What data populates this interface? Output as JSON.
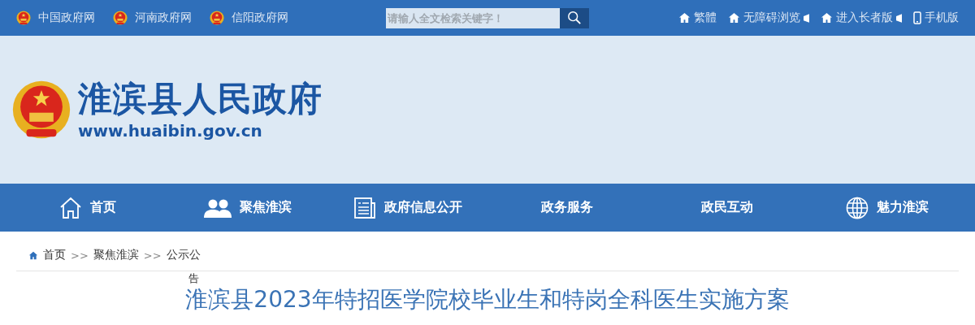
{
  "top_bar": {
    "gov_links": [
      {
        "label": "中国政府网"
      },
      {
        "label": "河南政府网"
      },
      {
        "label": "信阳政府网"
      }
    ],
    "search": {
      "placeholder": "请输人全文检索关键字！"
    },
    "right_links": [
      {
        "label": "繁體",
        "kind": "home"
      },
      {
        "label": "无障碍浏览",
        "kind": "overlay"
      },
      {
        "label": "进入长者版",
        "kind": "overlay"
      },
      {
        "label": "手机版",
        "kind": "mobile"
      }
    ]
  },
  "header": {
    "site_name": "淮滨县人民政府",
    "url": "www.huaibin.gov.cn"
  },
  "nav": [
    {
      "label": "首页",
      "kind": "home"
    },
    {
      "label": "聚焦淮滨",
      "kind": "people"
    },
    {
      "label": "政府信息公开",
      "kind": "document"
    },
    {
      "label": "政务服务",
      "kind": "none"
    },
    {
      "label": "政民互动",
      "kind": "none"
    },
    {
      "label": "魅力淮滨",
      "kind": "globe"
    }
  ],
  "breadcrumb": {
    "items": [
      {
        "label": "首页"
      },
      {
        "label": "聚焦淮滨"
      },
      {
        "label": "公示公"
      }
    ],
    "separator": ">>",
    "overflow": "告"
  },
  "article": {
    "title": "淮滨县2023年特招医学院校毕业生和特岗全科医生实施方案"
  }
}
